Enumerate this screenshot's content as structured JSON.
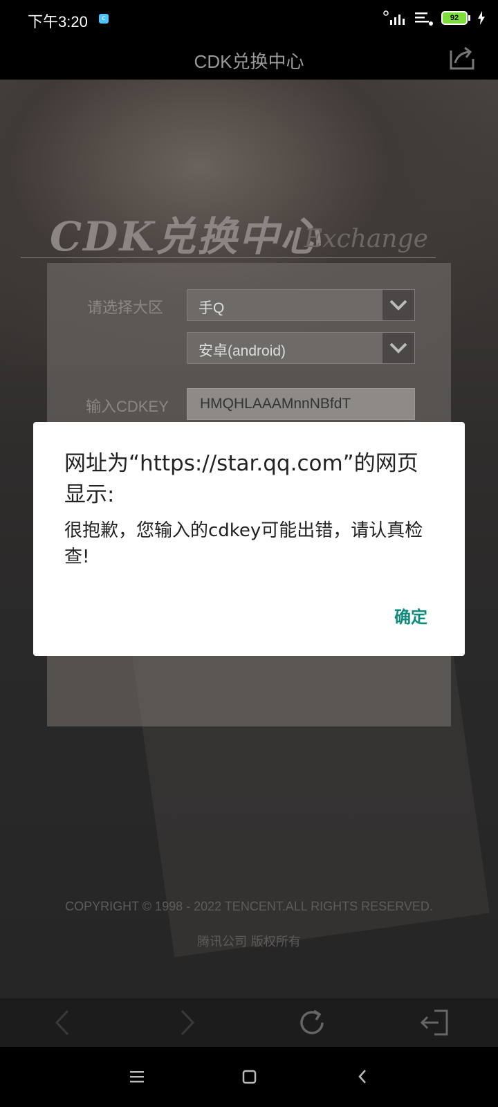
{
  "status_bar": {
    "time": "下午3:20",
    "battery": "92"
  },
  "header": {
    "title": "CDK兑换中心"
  },
  "hero": {
    "title": "CDK兑换中心",
    "subtitle": "Exchange"
  },
  "form": {
    "region_label": "请选择大区",
    "region_value": "手Q",
    "platform_value": "安卓(android)",
    "cdkey_label": "输入CDKEY",
    "cdkey_value": "HMQHLAAAMnnNBfdT"
  },
  "footer": {
    "copyright": "COPYRIGHT © 1998 - 2022 TENCENT.ALL RIGHTS RESERVED.",
    "rights_cn": "腾讯公司 版权所有"
  },
  "dialog": {
    "title": "网址为“https://star.qq.com”的网页显示:",
    "message": "很抱歉，您输入的cdkey可能出错，请认真检查!",
    "ok_label": "确定"
  },
  "colors": {
    "dialog_accent": "#0f8c7d",
    "battery_fill": "#7dde3b"
  }
}
